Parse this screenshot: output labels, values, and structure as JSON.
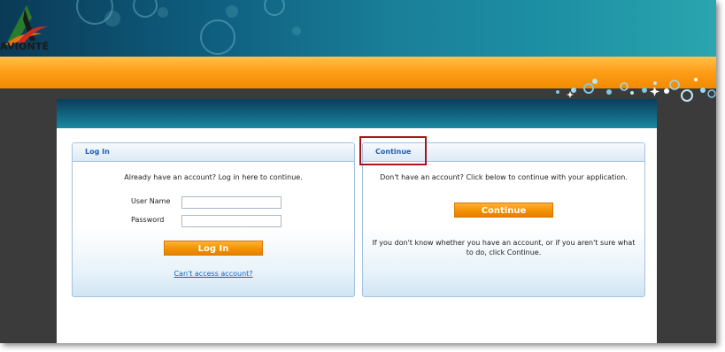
{
  "brand": {
    "logo_text": "AVIONTÉ"
  },
  "login_panel": {
    "title": "Log In",
    "intro": "Already have an account? Log in here to continue.",
    "username_label": "User Name",
    "username_value": "",
    "password_label": "Password",
    "password_value": "",
    "login_button": "Log In",
    "help_link": "Can't access account?"
  },
  "continue_panel": {
    "title": "Continue",
    "intro": "Don't have an account? Click below to continue with your application.",
    "continue_button": "Continue",
    "note": "If you don't know whether you have an account, or if you aren't sure what to do, click Continue."
  },
  "colors": {
    "accent_orange": "#f39200",
    "header_teal": "#126986",
    "panel_title_blue": "#1f5fb0",
    "link_blue": "#1a5fb4",
    "highlight_red": "#a4161a"
  }
}
